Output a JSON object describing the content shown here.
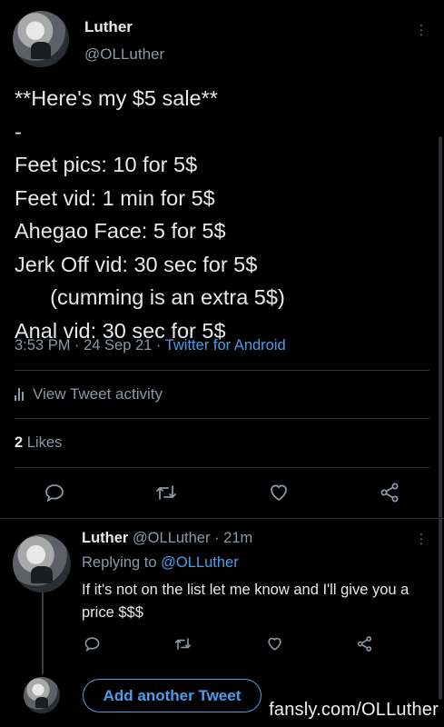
{
  "main_tweet": {
    "author_name": "Luther",
    "author_handle": "@OLLuther",
    "lines": [
      "**Here's my $5 sale**",
      "-",
      "Feet pics: 10 for 5$",
      "Feet vid: 1 min for 5$",
      "Ahegao Face: 5 for 5$",
      "Jerk Off vid: 30 sec for 5$",
      "      (cumming is an extra 5$)",
      "Anal vid: 30 sec for 5$"
    ],
    "timestamp": "3:53 PM · 24 Sep 21 · ",
    "source": "Twitter for Android",
    "activity_label": "View Tweet activity",
    "likes_count": "2",
    "likes_label": " Likes"
  },
  "reply_tweet": {
    "author_name": "Luther",
    "author_handle": "@OLLuther",
    "age": " · 21m",
    "replying_prefix": "Replying to ",
    "replying_mention": "@OLLuther",
    "text": "If it's not on the list let me know and I'll give you a price $$$"
  },
  "add_tweet_label": "Add another Tweet",
  "watermark": "fansly.com/OLLuther",
  "icons": {
    "reply": "reply-icon",
    "retweet": "retweet-icon",
    "like": "heart-icon",
    "share": "share-icon",
    "more": "more-icon",
    "activity": "bar-chart-icon"
  },
  "colors": {
    "background": "#000000",
    "text": "#e7e9ea",
    "secondary": "#8b98a5",
    "accent": "#4a9eea"
  }
}
